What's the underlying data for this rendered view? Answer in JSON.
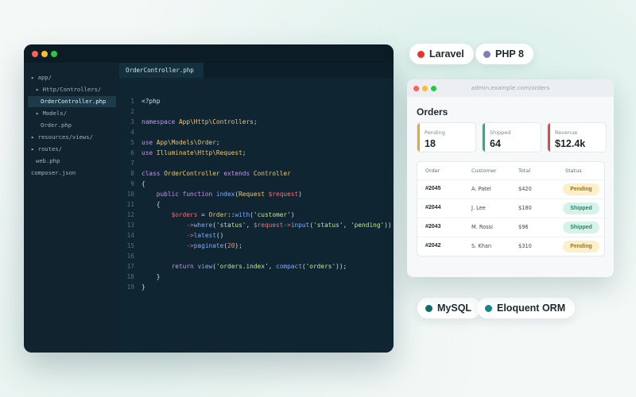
{
  "editor": {
    "active_tab": "OrderController.php",
    "file_tree": [
      "▸ app/",
      "▸ Http/Controllers/",
      "OrderController.php",
      "▸ Models/",
      "Order.php",
      "▸ resources/views/",
      "▸ routes/",
      "web.php",
      "composer.json"
    ]
  },
  "tech_pills": [
    {
      "label": "Laravel",
      "color": "#e8342d"
    },
    {
      "label": "PHP 8",
      "color": "#7b7fb8"
    },
    {
      "label": "MySQL",
      "color": "#0f6d72"
    },
    {
      "label": "Eloquent ORM",
      "color": "#17878a"
    }
  ],
  "admin": {
    "url": "admin.example.com/orders",
    "title": "Orders",
    "stats": [
      {
        "label": "Pending",
        "value": "18",
        "color": "#e8a732"
      },
      {
        "label": "Shipped",
        "value": "64",
        "color": "#27b27f"
      },
      {
        "label": "Revenue",
        "value": "$12.4k",
        "color": "#e04a4a"
      }
    ],
    "table": {
      "headers": [
        "Order",
        "Customer",
        "Total",
        "Status"
      ],
      "rows": [
        {
          "order": "#2045",
          "customer": "A. Patel",
          "total": "$420",
          "status": "Pending"
        },
        {
          "order": "#2044",
          "customer": "J. Lee",
          "total": "$180",
          "status": "Shipped"
        },
        {
          "order": "#2043",
          "customer": "M. Rossi",
          "total": "$96",
          "status": "Shipped"
        },
        {
          "order": "#2042",
          "customer": "S. Khan",
          "total": "$310",
          "status": "Pending"
        }
      ]
    }
  }
}
